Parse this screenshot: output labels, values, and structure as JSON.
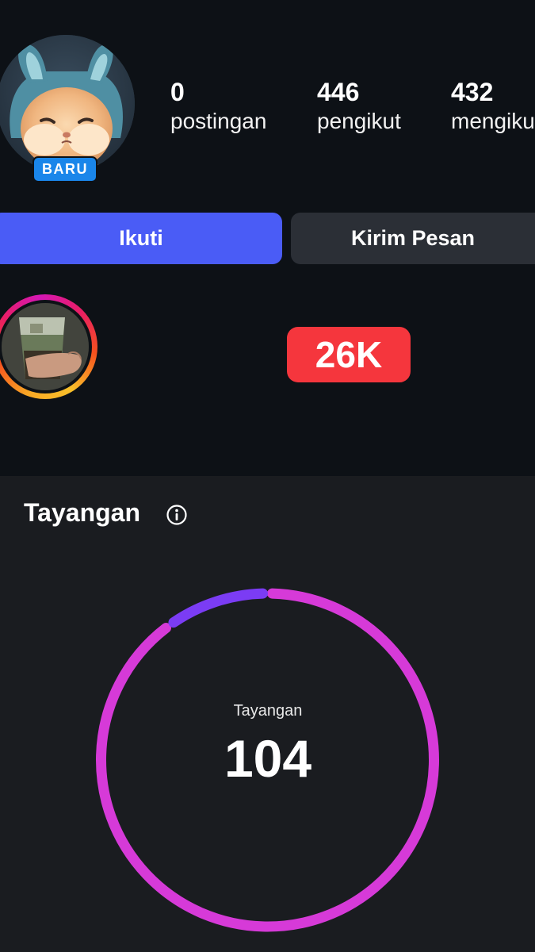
{
  "profile": {
    "badge": "BARU",
    "stats": [
      {
        "value": "0",
        "label": "postingan"
      },
      {
        "value": "446",
        "label": "pengikut"
      },
      {
        "value": "432",
        "label": "mengikuti"
      }
    ]
  },
  "actions": {
    "follow_label": "Ikuti",
    "message_label": "Kirim Pesan"
  },
  "highlight": {
    "count_badge": "26K"
  },
  "insights": {
    "title": "Tayangan",
    "info_icon": "info-icon",
    "donut_label": "Tayangan",
    "donut_value": "104",
    "donut_share_primary": 0.9,
    "donut_share_secondary": 0.1,
    "colors": {
      "primary": "#d63ad8",
      "secondary": "#7b3cf4"
    }
  },
  "colors": {
    "follow_button": "#4a5cf6",
    "message_button": "#2b2f36",
    "new_badge": "#1a86ea",
    "count_badge": "#f5363d",
    "background": "#0d1116",
    "panel": "#1a1c20"
  }
}
